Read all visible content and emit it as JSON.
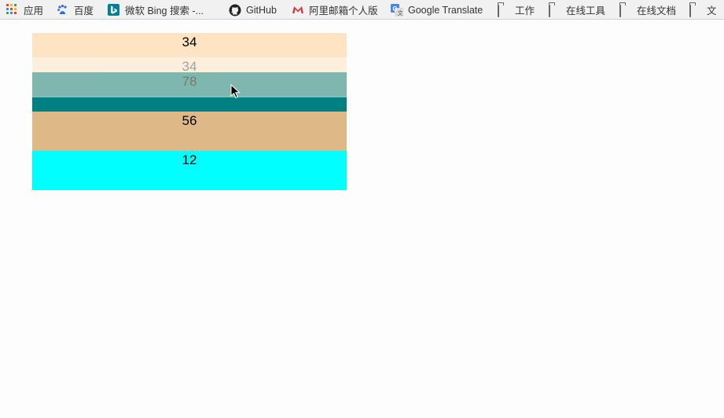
{
  "bookmarks": [
    {
      "label": "应用",
      "icon": "apps-icon"
    },
    {
      "label": "百度",
      "icon": "baidu-icon"
    },
    {
      "label": "微软 Bing 搜索 -...",
      "icon": "bing-icon"
    },
    {
      "label": "GitHub",
      "icon": "github-icon"
    },
    {
      "label": "阿里邮箱个人版",
      "icon": "alimail-icon"
    },
    {
      "label": "Google Translate",
      "icon": "google-translate-icon"
    },
    {
      "label": "工作",
      "icon": "folder-icon"
    },
    {
      "label": "在线工具",
      "icon": "folder-icon"
    },
    {
      "label": "在线文档",
      "icon": "folder-icon"
    },
    {
      "label": "文",
      "icon": "folder-icon"
    }
  ],
  "items": [
    {
      "label": "34",
      "color": "#ffe4c4"
    },
    {
      "label": "34",
      "color": "#ffe4c4"
    },
    {
      "label": "78",
      "color": "#008080"
    },
    {
      "label": "56",
      "color": "#deb887"
    },
    {
      "label": "12",
      "color": "#00ffff"
    }
  ]
}
